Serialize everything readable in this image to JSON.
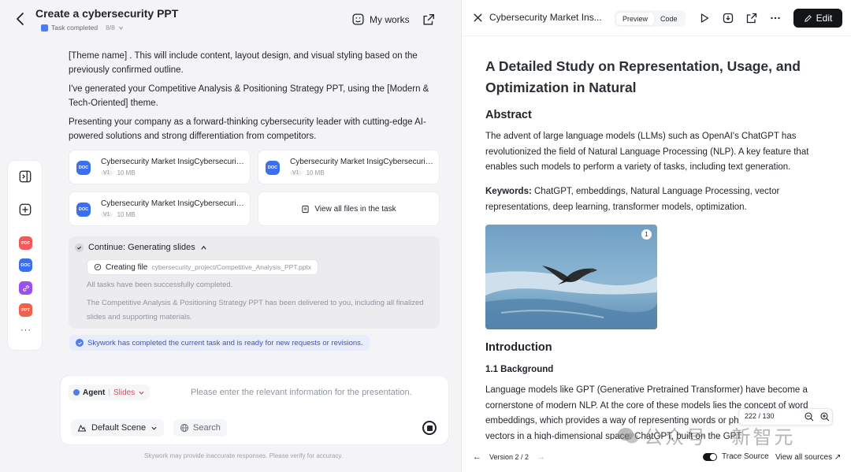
{
  "header": {
    "title": "Create a cybersecurity PPT",
    "task_status": "Task completed",
    "task_count": "8/8",
    "my_works": "My works"
  },
  "messages": [
    "[Theme name] . This will include content, layout design, and visual styling based on the previously confirmed outline.",
    "I've generated your Competitive Analysis & Positioning Strategy PPT, using the [Modern & Tech-Oriented] theme.",
    "Presenting your company as a forward-thinking cybersecurity leader with cutting-edge AI-powered solutions and strong differentiation from competitors."
  ],
  "files": [
    {
      "icon": "DOC",
      "name": "Cybersecurity Market InsigCybersecurity Market Insights",
      "version": "V1",
      "size": "10 MB"
    },
    {
      "icon": "DOC",
      "name": "Cybersecurity Market InsigCybersecurity Market Insights",
      "version": "V1",
      "size": "10 MB"
    },
    {
      "icon": "DOC",
      "name": "Cybersecurity Market InsigCybersecurity Market Insights",
      "version": "V1",
      "size": "10 MB"
    }
  ],
  "view_all_files": "View all files in the task",
  "progress": {
    "heading": "Continue: Generating slides",
    "creating_label": "Creating file",
    "creating_path": "cybersecurity_project/Competitive_Analysis_PPT.pptx",
    "line1": "All tasks have been successfully completed.",
    "line2": "The Competitive Analysis & Positioning Strategy PPT has been delivered to you, including all finalized slides and supporting materials."
  },
  "done_note": "Skywork has completed the current task and is ready for new requests or revisions.",
  "strip_badges": [
    "PDF",
    "DOC",
    "LINK",
    "PPT"
  ],
  "composer": {
    "agent": "Agent",
    "mode": "Slides",
    "placeholder": "Please enter the relevant information for the presentation.",
    "scene": "Default Scene",
    "search": "Search"
  },
  "disclaimer": "Skywork may provide inaccurate responses. Please verify for accuracy.",
  "right": {
    "doc_title": "Cybersecurity Market Ins...",
    "tab_preview": "Preview",
    "tab_code": "Code",
    "edit": "Edit",
    "h1": "A Detailed Study on Representation, Usage, and Optimization in Natural",
    "abstract_h": "Abstract",
    "abstract": "The advent of large language models (LLMs) such as OpenAI's ChatGPT has revolutionized the field of Natural Language Processing (NLP). A key feature that enables such models to perform a variety of tasks, including text generation.",
    "keywords_label": "Keywords:",
    "keywords": " ChatGPT, embeddings, Natural Language Processing, vector representations, deep learning, transformer models, optimization.",
    "photo_num": "1",
    "intro_h": "Introduction",
    "background_h": "1.1 Background",
    "background": "Language models like GPT (Generative Pretrained Transformer) have become a cornerstone of modern NLP. At the core of these models lies the concept of word embeddings, which provides a way of representing words or phrases as continuous vectors in a high-dimensional space. ChatGPT, built on the GPT",
    "page_current": "222",
    "page_total": "130",
    "version": "Version 2 / 2",
    "trace": "Trace Source",
    "view_sources": "View all sources"
  },
  "watermark": "公众号 · 新智元",
  "colors": {
    "accent": "#4e7cf6",
    "doc_icon": "#3a6ff0",
    "pdf_badge": "#f25a5a",
    "doc_badge": "#3a6ff0",
    "link_badge": "#9b4ff0",
    "ppt_badge": "#f2604a",
    "slides_label": "#e0445b"
  }
}
